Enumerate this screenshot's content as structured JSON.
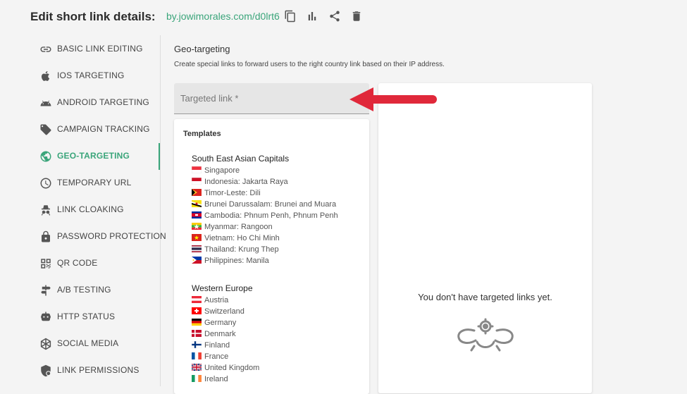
{
  "header": {
    "title": "Edit short link details:",
    "short_link": "by.jowimorales.com/d0lrt6",
    "icons": [
      "copy-icon",
      "stats-icon",
      "share-icon",
      "delete-icon"
    ]
  },
  "sidebar": {
    "items": [
      {
        "label": "BASIC LINK EDITING",
        "icon": "link-icon"
      },
      {
        "label": "IOS TARGETING",
        "icon": "apple-icon"
      },
      {
        "label": "ANDROID TARGETING",
        "icon": "android-icon"
      },
      {
        "label": "CAMPAIGN TRACKING",
        "icon": "tag-icon"
      },
      {
        "label": "GEO-TARGETING",
        "icon": "globe-icon",
        "active": true
      },
      {
        "label": "TEMPORARY URL",
        "icon": "clock-icon"
      },
      {
        "label": "LINK CLOAKING",
        "icon": "spy-icon"
      },
      {
        "label": "PASSWORD PROTECTION",
        "icon": "lock-icon"
      },
      {
        "label": "QR CODE",
        "icon": "qr-icon"
      },
      {
        "label": "A/B TESTING",
        "icon": "signpost-icon"
      },
      {
        "label": "HTTP STATUS",
        "icon": "robot-icon"
      },
      {
        "label": "SOCIAL MEDIA",
        "icon": "social-icon"
      },
      {
        "label": "LINK PERMISSIONS",
        "icon": "shield-icon"
      }
    ]
  },
  "main": {
    "title": "Geo-targeting",
    "description": "Create special links to forward users to the right country link based on their IP address.",
    "targeted_link_label": "Targeted link *",
    "templates": {
      "title": "Templates",
      "groups": [
        {
          "name": "South East Asian Capitals",
          "items": [
            {
              "label": "Singapore",
              "flag": "sg"
            },
            {
              "label": "Indonesia: Jakarta Raya",
              "flag": "id"
            },
            {
              "label": "Timor-Leste: Dili",
              "flag": "tl"
            },
            {
              "label": "Brunei Darussalam: Brunei and Muara",
              "flag": "bn"
            },
            {
              "label": "Cambodia: Phnum Penh, Phnum Penh",
              "flag": "kh"
            },
            {
              "label": "Myanmar: Rangoon",
              "flag": "mm"
            },
            {
              "label": "Vietnam: Ho Chi Minh",
              "flag": "vn"
            },
            {
              "label": "Thailand: Krung Thep",
              "flag": "th"
            },
            {
              "label": "Philippines: Manila",
              "flag": "ph"
            }
          ]
        },
        {
          "name": "Western Europe",
          "items": [
            {
              "label": "Austria",
              "flag": "at"
            },
            {
              "label": "Switzerland",
              "flag": "ch"
            },
            {
              "label": "Germany",
              "flag": "de"
            },
            {
              "label": "Denmark",
              "flag": "dk"
            },
            {
              "label": "Finland",
              "flag": "fi"
            },
            {
              "label": "France",
              "flag": "fr"
            },
            {
              "label": "United Kingdom",
              "flag": "gb"
            },
            {
              "label": "Ireland",
              "flag": "ie"
            }
          ]
        }
      ]
    },
    "empty_state": {
      "message": "You don't have targeted links yet.",
      "icon": "broken-chain-icon"
    }
  },
  "colors": {
    "accent": "#3aa57a",
    "annotation_arrow": "#e0283a"
  }
}
